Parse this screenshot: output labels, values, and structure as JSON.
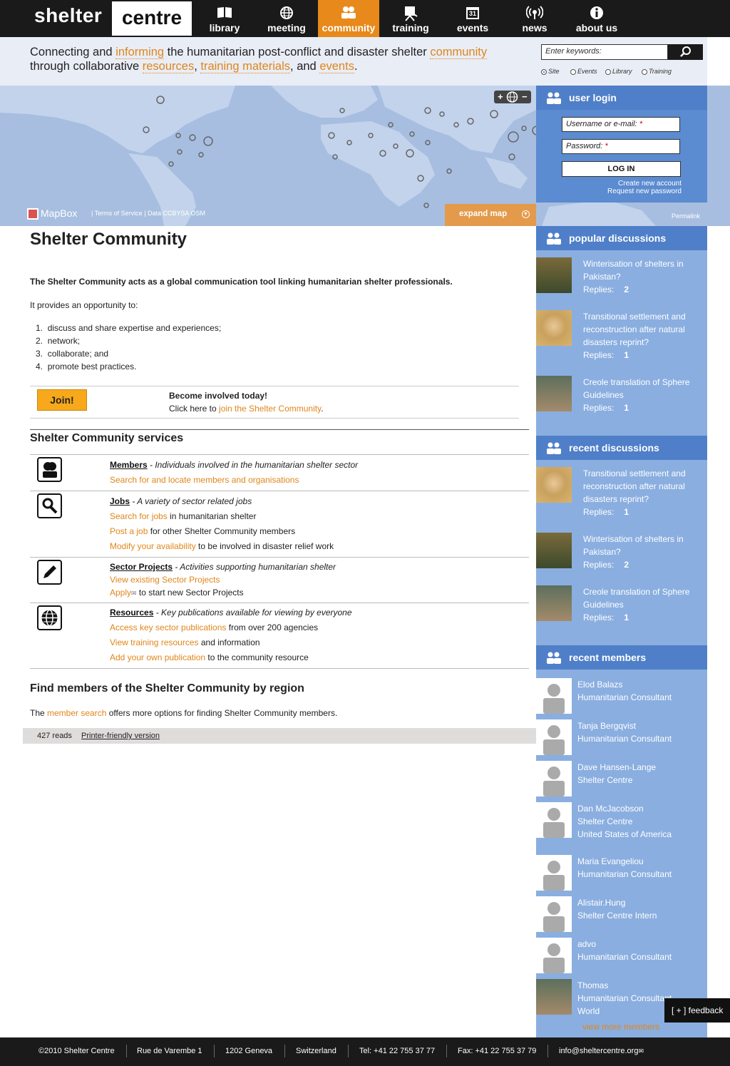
{
  "header": {
    "logo_left": "shelter",
    "logo_right": "centre",
    "nav": [
      {
        "label": "library",
        "icon": "book-icon"
      },
      {
        "label": "meeting",
        "icon": "globe-icon"
      },
      {
        "label": "community",
        "icon": "people-icon",
        "active": true
      },
      {
        "label": "training",
        "icon": "board-icon"
      },
      {
        "label": "events",
        "icon": "calendar-icon",
        "calendar_day": "31"
      },
      {
        "label": "news",
        "icon": "broadcast-icon"
      },
      {
        "label": "about us",
        "icon": "info-icon"
      }
    ]
  },
  "tagline": {
    "p1": "Connecting and ",
    "l1": "informing",
    "p2": " the humanitarian post-conflict and disaster shelter ",
    "l2": "community",
    "p3": "through collaborative ",
    "l3": "resources",
    "p4": ", ",
    "l4": "training materials",
    "p5": ", and ",
    "l5": "events",
    "p6": "."
  },
  "search": {
    "placeholder": "Enter keywords:",
    "scopes": [
      "Site",
      "Events",
      "Library",
      "Training"
    ],
    "selected": "Site"
  },
  "map": {
    "attribution_logo": "MapBox",
    "terms": "| Terms of Service | Data CCBYSA OSM",
    "expand_label": "expand map",
    "permalink": "Permalink",
    "zoom_in": "+",
    "zoom_out": "−"
  },
  "login": {
    "title": "user login",
    "username_label": "Username or e-mail:",
    "password_label": "Password:",
    "required_mark": "*",
    "button": "LOG IN",
    "create_account": "Create new account",
    "request_password": "Request new password"
  },
  "popular": {
    "title": "popular discussions",
    "items": [
      {
        "title": "Winterisation of shelters in Pakistan?",
        "replies_label": "Replies:",
        "replies": "2"
      },
      {
        "title": "Transitional settlement and reconstruction after natural disasters reprint?",
        "replies_label": "Replies:",
        "replies": "1"
      },
      {
        "title": "Creole translation of Sphere Guidelines",
        "replies_label": "Replies:",
        "replies": "1"
      }
    ]
  },
  "recent": {
    "title": "recent discussions",
    "items": [
      {
        "title": "Transitional settlement and reconstruction after natural disasters reprint?",
        "replies_label": "Replies:",
        "replies": "1"
      },
      {
        "title": "Winterisation of shelters in Pakistan?",
        "replies_label": "Replies:",
        "replies": "2"
      },
      {
        "title": "Creole translation of Sphere Guidelines",
        "replies_label": "Replies:",
        "replies": "1"
      }
    ]
  },
  "members": {
    "title": "recent members",
    "items": [
      {
        "name": "Elod Balazs",
        "role": "Humanitarian Consultant",
        "extra": ""
      },
      {
        "name": "Tanja Bergqvist",
        "role": "Humanitarian Consultant",
        "extra": ""
      },
      {
        "name": "Dave Hansen-Lange",
        "role": "Shelter Centre",
        "extra": ""
      },
      {
        "name": "Dan McJacobson",
        "role": "Shelter Centre",
        "extra": "United States of America"
      },
      {
        "name": "Maria Evangeliou",
        "role": "Humanitarian Consultant",
        "extra": ""
      },
      {
        "name": "Alistair.Hung",
        "role": "Shelter Centre Intern",
        "extra": ""
      },
      {
        "name": "advo",
        "role": "Humanitarian Consultant",
        "extra": ""
      },
      {
        "name": "Thomas",
        "role": "Humanitarian Consultant",
        "extra": "World"
      }
    ],
    "view_more": "view more members"
  },
  "main": {
    "title": "Shelter Community",
    "intro_bold": "The Shelter Community acts as a global communication tool linking humanitarian shelter professionals.",
    "intro_text": "It provides an opportunity to:",
    "list": [
      "discuss and share expertise and experiences;",
      "network;",
      "collaborate; and",
      "promote best practices."
    ],
    "join_button": "Join!",
    "join_head": "Become involved today!",
    "join_text_pre": "Click here to ",
    "join_link": "join the Shelter Community",
    "join_text_post": ".",
    "services_title": "Shelter Community services",
    "services": {
      "members_title": "Members",
      "members_desc": " - Individuals involved in the humanitarian shelter sector",
      "members_link": "Search for and locate members and organisations",
      "jobs_title": "Jobs",
      "jobs_desc": " - A variety of sector related jobs",
      "jobs_l1": "Search for jobs",
      "jobs_t1": " in humanitarian shelter",
      "jobs_l2": "Post a job",
      "jobs_t2": " for other Shelter Community members",
      "jobs_l3": "Modify your availability",
      "jobs_t3": " to be involved in disaster relief work",
      "projects_title": "Sector Projects",
      "projects_desc": " - Activities supporting humanitarian shelter",
      "projects_l1": "View existing Sector Projects",
      "projects_l2": "Apply",
      "projects_t2": " to start new Sector Projects",
      "resources_title": "Resources",
      "resources_desc": " - Key publications available for viewing by everyone",
      "resources_l1": "Access key sector publications",
      "resources_t1": " from over 200 agencies",
      "resources_l2": "View training resources",
      "resources_t2": " and information",
      "resources_l3": "Add your own publication",
      "resources_t3": " to the community resource"
    },
    "region_title": "Find members of the Shelter Community by region",
    "region_pre": "The ",
    "region_link": "member search",
    "region_post": " offers more options for finding Shelter Community members.",
    "reads": "427 reads",
    "printer": "Printer-friendly version"
  },
  "footer": {
    "items": [
      "©2010 Shelter Centre",
      "Rue de Varembe 1",
      "1202 Geneva",
      "Switzerland",
      "Tel: +41 22 755 37 77",
      "Fax: +41 22 755 37 79",
      "info@sheltercentre.org"
    ]
  },
  "feedback": "[ + ] feedback",
  "colors": {
    "accent": "#e8891b",
    "sidebar": "#8aaee0",
    "sidebar_head": "#4f7fc8",
    "header": "#1a1a1a",
    "map": "#a7bee0"
  }
}
